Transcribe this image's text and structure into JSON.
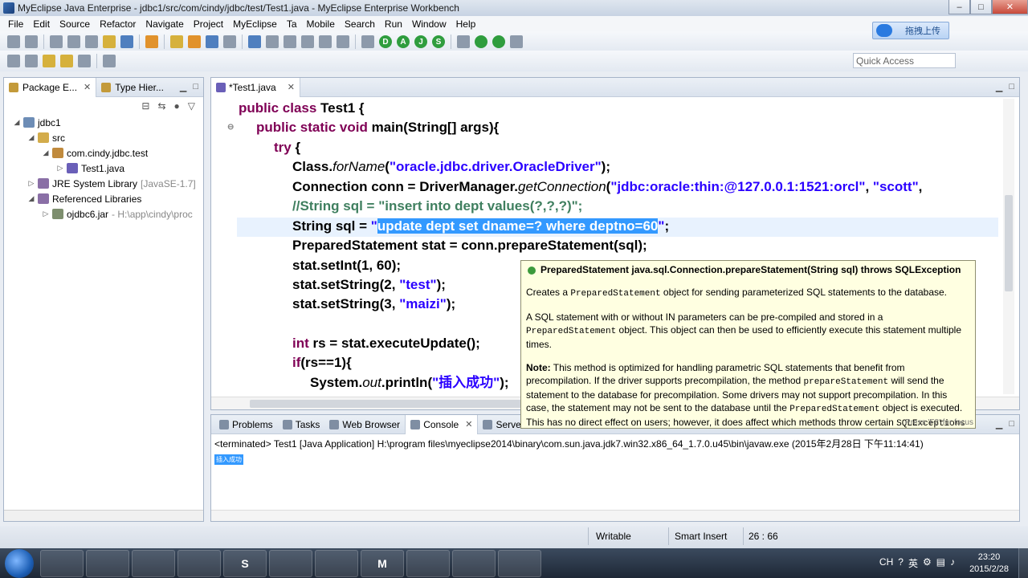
{
  "window": {
    "title": "MyEclipse Java Enterprise - jdbc1/src/com/cindy/jdbc/test/Test1.java - MyEclipse Enterprise Workbench",
    "minimize": "–",
    "maximize": "□",
    "close": "✕"
  },
  "menu": [
    "File",
    "Edit",
    "Source",
    "Refactor",
    "Navigate",
    "Project",
    "MyEclipse",
    "Ta",
    "Mobile",
    "Search",
    "Run",
    "Window",
    "Help"
  ],
  "toolbar": {
    "letters": [
      "D",
      "A",
      "J",
      "S"
    ],
    "upload_label": "拖拽上传",
    "quick_access_placeholder": "Quick Access"
  },
  "left_view": {
    "tabs": [
      {
        "label": "Package E...",
        "close": "✕"
      },
      {
        "label": "Type Hier...",
        "close": ""
      }
    ],
    "tree": [
      {
        "label": "jdbc1",
        "arrow": "◢",
        "decor": ""
      },
      {
        "label": "src",
        "arrow": "◢",
        "decor": ""
      },
      {
        "label": "com.cindy.jdbc.test",
        "arrow": "◢",
        "decor": ""
      },
      {
        "label": "Test1.java",
        "arrow": "▷",
        "decor": ""
      },
      {
        "label": "JRE System Library",
        "arrow": "▷",
        "decor": "[JavaSE-1.7]"
      },
      {
        "label": "Referenced Libraries",
        "arrow": "◢",
        "decor": ""
      },
      {
        "label": "ojdbc6.jar",
        "arrow": "▷",
        "decor": "- H:\\app\\cindy\\proc"
      }
    ]
  },
  "editor": {
    "tab_label": "*Test1.java",
    "tab_close": "✕",
    "lines": {
      "l1_kw": "public class ",
      "l1_rest": "Test1 {",
      "l2_kw": "public static void ",
      "l2_rest": "main(String[] args){",
      "l3_kw": "try",
      "l3_rest": " {",
      "l4_a": "Class.",
      "l4_i": "forName",
      "l4_b": "(",
      "l4_s": "\"oracle.jdbc.driver.OracleDriver\"",
      "l4_c": ");",
      "l5_a": "Connection conn = DriverManager.",
      "l5_i": "getConnection",
      "l5_b": "(",
      "l5_s1": "\"jdbc:oracle:thin:@127.0.0.1:1521:orcl\"",
      "l5_c": ", ",
      "l5_s2": "\"scott\"",
      "l5_d": ",",
      "l6": "//String sql = \"insert into dept values(?,?,?)\";",
      "l7_a": "String sql = ",
      "l7_q1": "\"",
      "l7_sel": "update dept set dname=? where deptno=60",
      "l7_q2": "\"",
      "l7_end": ";",
      "l8": "PreparedStatement stat = conn.prepareStatement(sql);",
      "l9": "stat.setInt(1, 60);",
      "l10_a": "stat.setString(2, ",
      "l10_s": "\"test\"",
      "l10_b": ");",
      "l11_a": "stat.setString(3, ",
      "l11_s": "\"maizi\"",
      "l11_b": ");",
      "l12_kw": "int",
      "l12_rest": " rs = stat.executeUpdate();",
      "l13_kw": "if",
      "l13_rest": "(rs==1){",
      "l14_a": "System.",
      "l14_i": "out",
      "l14_b": ".println(",
      "l14_s": "\"插入成功\"",
      "l14_c": ");"
    }
  },
  "hover": {
    "signature": "PreparedStatement java.sql.Connection.prepareStatement(String sql) throws SQLException",
    "p1_a": "Creates a ",
    "p1_code": "PreparedStatement",
    "p1_b": " object for sending parameterized SQL statements to the database.",
    "p2_a": "A SQL statement with or without IN parameters can be pre-compiled and stored in a ",
    "p2_code": "PreparedStatement",
    "p2_b": " object. This object can then be used to efficiently execute this statement multiple times.",
    "p3_note": "Note:",
    "p3_a": " This method is optimized for handling parametric SQL statements that benefit from precompilation. If the driver supports precompilation, the method ",
    "p3_code1": "prepareStatement",
    "p3_b": " will send the statement to the database for precompilation. Some drivers may not support precompilation. In this case, the statement may not be sent to the database until the ",
    "p3_code2": "PreparedStatement",
    "p3_c": " object is executed.",
    "p3_d": " This has no direct effect on users; however, it does affect which methods throw certain ",
    "p3_code3": "SQLExceptions",
    "footer": "Press 'F2' for focus"
  },
  "bottom": {
    "tabs": [
      {
        "label": "Problems",
        "close": ""
      },
      {
        "label": "Tasks",
        "close": ""
      },
      {
        "label": "Web Browser",
        "close": ""
      },
      {
        "label": "Console",
        "close": "✕"
      },
      {
        "label": "Servers",
        "close": ""
      }
    ],
    "terminated_line": "<terminated> Test1 [Java Application] H:\\program files\\myeclipse2014\\binary\\com.sun.java.jdk7.win32.x86_64_1.7.0.u45\\bin\\javaw.exe (2015年2月28日 下午11:14:41)",
    "output": "插入成功"
  },
  "status": {
    "writable": "Writable",
    "insert_mode": "Smart Insert",
    "position": "26 : 66"
  },
  "taskbar": {
    "apps": [
      "",
      "",
      "",
      "",
      "S",
      "",
      "",
      "",
      "M",
      "",
      "",
      ""
    ],
    "tray_lang": "CH",
    "tray_ime": "英",
    "time": "23:20",
    "date": "2015/2/28"
  }
}
